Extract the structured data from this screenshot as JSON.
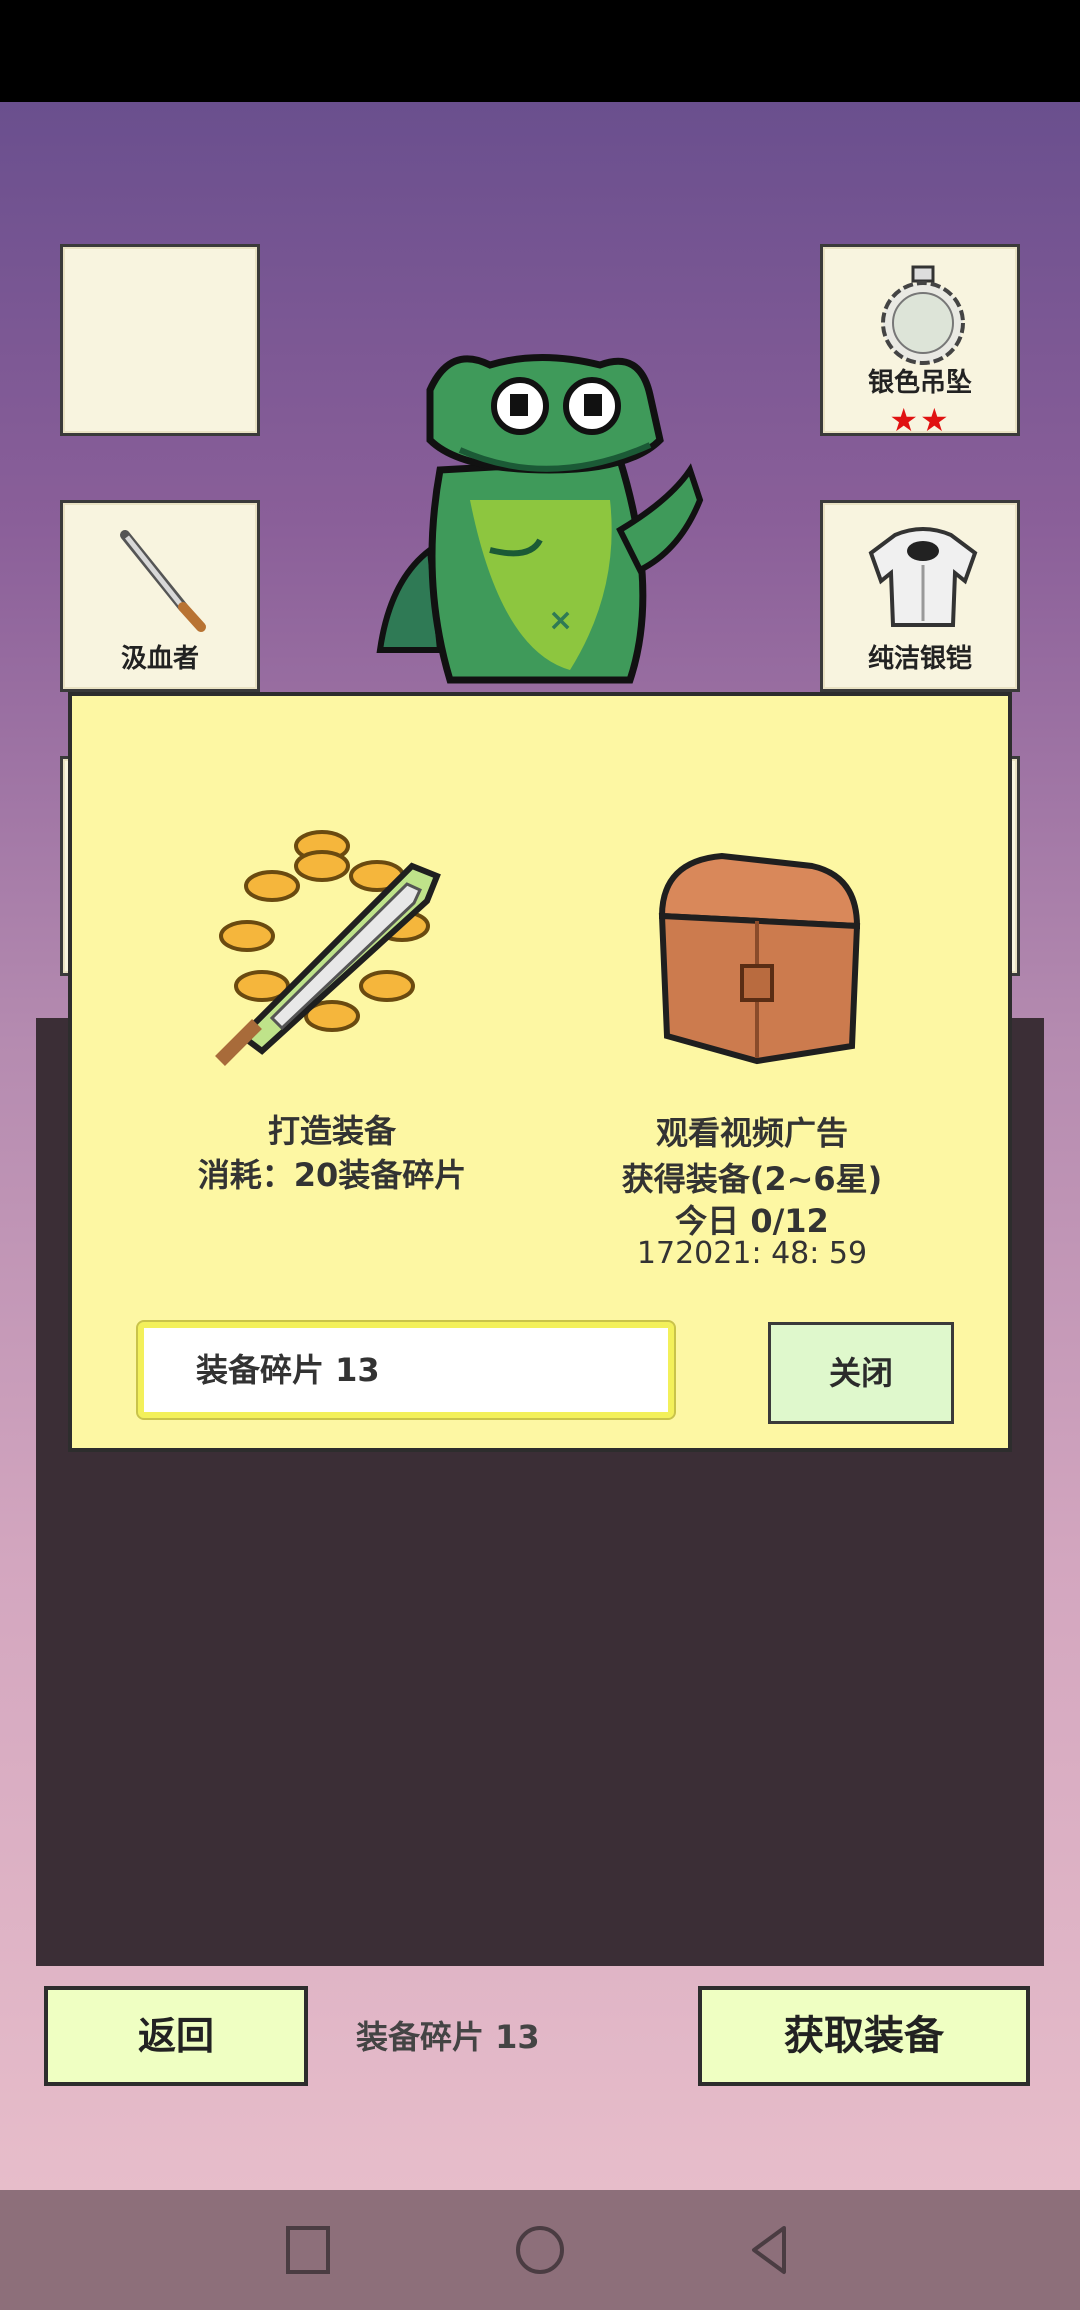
{
  "slots": {
    "left_top": {
      "label": ""
    },
    "left_mid": {
      "label": "汲血者"
    },
    "right_top": {
      "label": "银色吊坠",
      "stars": "★★"
    },
    "right_mid": {
      "label": "纯洁银铠"
    }
  },
  "dialog": {
    "craft": {
      "title": "打造装备",
      "cost": "消耗：20装备碎片"
    },
    "video": {
      "title": "观看视频广告",
      "subtitle": "获得装备(2~6星)",
      "today": "今日 0/12",
      "timer": "172021: 48: 59"
    },
    "shard_field": "装备碎片  13",
    "close_label": "关闭"
  },
  "footer": {
    "back_label": "返回",
    "shard_count": "装备碎片  13",
    "obtain_label": "获取装备"
  },
  "icons": {
    "frog": "frog-character-icon",
    "knife": "knife-icon",
    "pendant": "silver-pendant-icon",
    "armor": "silver-armor-icon",
    "craft": "crafting-sword-coins-icon",
    "chest": "treasure-chest-icon"
  }
}
